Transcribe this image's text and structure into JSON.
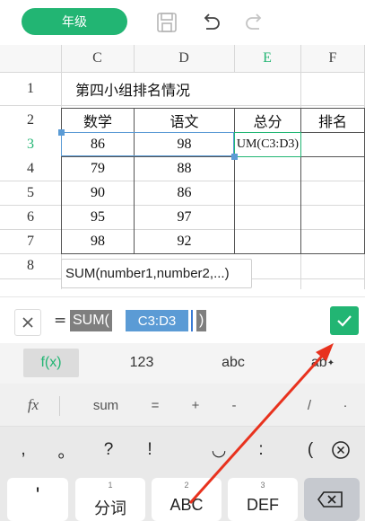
{
  "toolbar": {
    "sheet_tab": "年级",
    "icons": {
      "save": "save-icon",
      "undo": "undo-icon",
      "redo": "redo-icon"
    }
  },
  "grid": {
    "columns": [
      "C",
      "D",
      "E",
      "F"
    ],
    "active_column": "E",
    "rows": [
      {
        "num": "1",
        "cells": [
          "第四小组排名情况",
          "",
          "",
          ""
        ]
      },
      {
        "num": "2",
        "cells": [
          "数学",
          "语文",
          "总分",
          "排名"
        ]
      },
      {
        "num": "3",
        "cells": [
          "86",
          "98",
          "UM(C3:D3)",
          ""
        ]
      },
      {
        "num": "4",
        "cells": [
          "79",
          "88",
          "",
          ""
        ]
      },
      {
        "num": "5",
        "cells": [
          "90",
          "86",
          "",
          ""
        ]
      },
      {
        "num": "6",
        "cells": [
          "95",
          "97",
          "",
          ""
        ]
      },
      {
        "num": "7",
        "cells": [
          "98",
          "92",
          "",
          ""
        ]
      },
      {
        "num": "8",
        "cells": [
          "",
          "",
          "",
          ""
        ]
      }
    ],
    "active_row": "3",
    "function_hint": "SUM(number1,number2,...)"
  },
  "formula_bar": {
    "equals": "=",
    "func": "SUM(",
    "reference": "C3:D3",
    "close_paren": ")"
  },
  "function_tabs": [
    "f(x)",
    "123",
    "abc",
    "ab"
  ],
  "keyboard": {
    "suggestions": [
      "fx",
      "sum",
      "=",
      "+",
      "-",
      "/",
      "·"
    ],
    "symbols": [
      ",",
      "。",
      "?",
      "!",
      "◡",
      ":",
      "("
    ],
    "keys": [
      {
        "num": "",
        "label": "'"
      },
      {
        "num": "1",
        "label": "分词"
      },
      {
        "num": "2",
        "label": "ABC"
      },
      {
        "num": "3",
        "label": "DEF"
      }
    ]
  },
  "colors": {
    "accent": "#22b573",
    "selection": "#5b9bd5",
    "annotation_arrow": "#e8321e"
  }
}
